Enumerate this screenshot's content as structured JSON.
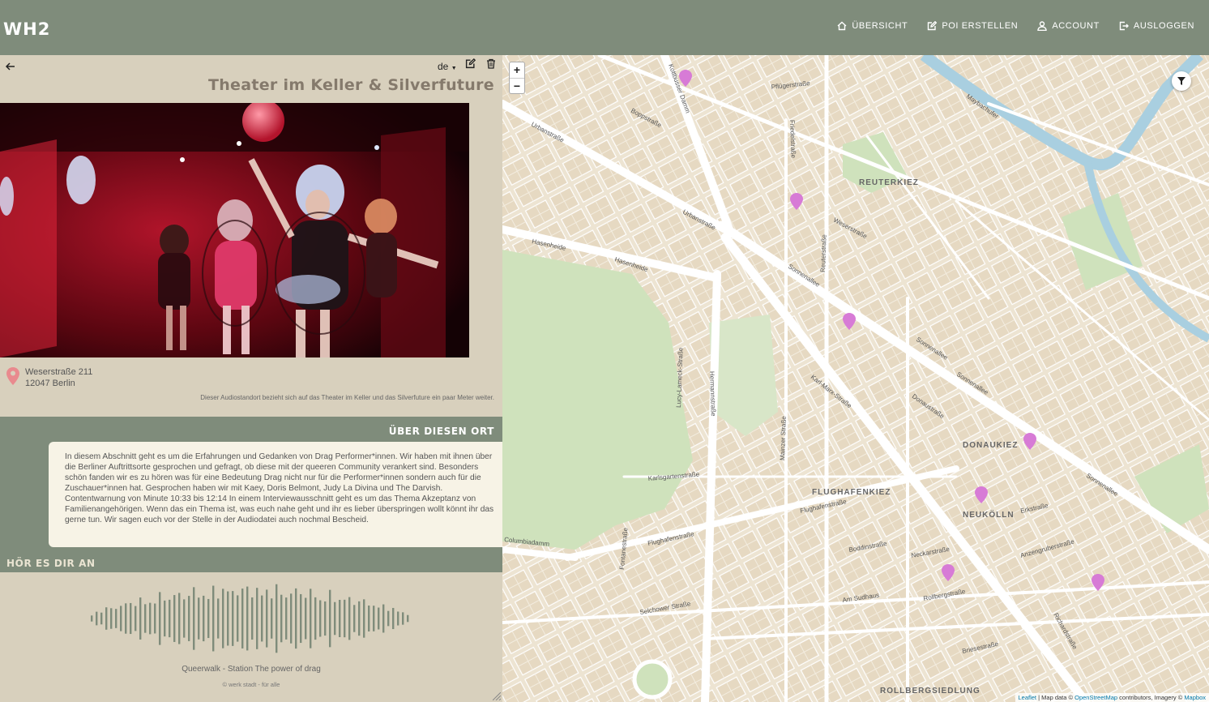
{
  "app": {
    "logo": "WH2"
  },
  "nav": [
    {
      "label": "ÜBERSICHT",
      "icon": "home-icon"
    },
    {
      "label": "POI ERSTELLEN",
      "icon": "edit-icon"
    },
    {
      "label": "ACCOUNT",
      "icon": "user-icon"
    },
    {
      "label": "AUSLOGGEN",
      "icon": "logout-icon"
    }
  ],
  "poi": {
    "language": "de",
    "title": "Theater im Keller & Silverfuture",
    "address_line1": "Weserstraße 211",
    "address_line2": "12047 Berlin",
    "note": "Dieser Audiostandort bezieht sich auf das Theater im Keller und das Silverfuture ein paar Meter weiter.",
    "about_heading": "ÜBER DIESEN ORT",
    "about_text": "In diesem Abschnitt geht es um die Erfahrungen und Gedanken von Drag Performer*innen. Wir haben mit ihnen über die Berliner Auftrittsorte gesprochen und gefragt, ob diese mit der queeren Community verankert sind. Besonders schön fanden wir es zu hören was für eine Bedeutung Drag nicht nur für die Performer*innen sondern auch für die Zuschauer*innen hat. Gesprochen haben wir mit Kaey, Doris Belmont, Judy La Divina und The Darvish. Contentwarnung von Minute 10:33 bis 12:14 In einem Interviewausschnitt geht es um das Thema Akzeptanz von Familienangehörigen. Wenn das ein Thema ist, was euch nahe geht und ihr es lieber überspringen wollt könnt ihr das gerne tun. Wir sagen euch vor der Stelle in der Audiodatei auch nochmal Bescheid.",
    "listen_heading": "HÖR ES DIR AN",
    "track_title": "Queerwalk - Station The power of drag",
    "copyright": "© werk stadt - für alle"
  },
  "map": {
    "zoom_in": "+",
    "zoom_out": "−",
    "attribution_leaflet": "Leaflet",
    "attribution_mid": " | Map data © ",
    "attribution_osm": "OpenStreetMap",
    "attribution_rest": " contributors, Imagery © ",
    "attribution_mapbox": "Mapbox",
    "district_labels": [
      "REUTERKIEZ",
      "DONAUKIEZ",
      "FLUGHAFENKIEZ",
      "NEUKÖLLN",
      "ROLLBERGSIEDLUNG"
    ],
    "street_labels": [
      "Urbanstraße",
      "Hasenheide",
      "Sonnenallee",
      "Karl-Marx-Straße",
      "Hermannstraße",
      "Flughafenstraße",
      "Weserstraße",
      "Pflügerstraße",
      "Kottbusser Damm",
      "Boppstraße",
      "Maybachufer",
      "Reuterstraße",
      "Donaustraße",
      "Rollbergstraße",
      "Neckarstraße",
      "Boddinstraße",
      "Erkstraße",
      "Briesestraße",
      "Am Sudhaus",
      "Selchower Straße",
      "Friedelstraße",
      "Lucy-Lameck-Straße",
      "Columbiadamm",
      "Fontanestraße",
      "Mainzer Straße",
      "Karlsgartenstraße",
      "Anzengruberstraße",
      "Richardstraße"
    ],
    "marker_color": "#d77bd6"
  }
}
